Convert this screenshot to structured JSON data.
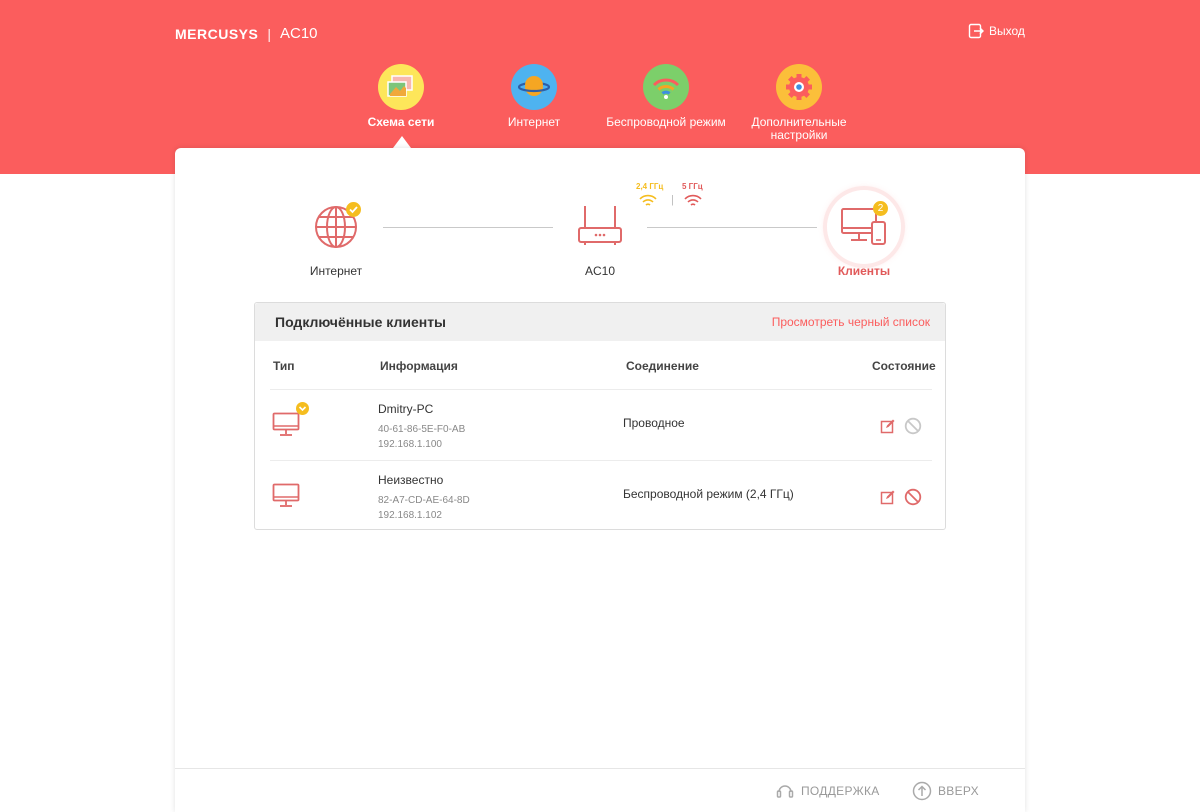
{
  "header": {
    "brand": "MERCUSYS",
    "separator": "|",
    "model": "AC10",
    "logout_label": "Выход"
  },
  "nav": {
    "items": [
      {
        "label": "Схема сети",
        "icon": "network-map-icon",
        "active": true
      },
      {
        "label": "Интернет",
        "icon": "internet-planet-icon",
        "active": false
      },
      {
        "label": "Беспроводной режим",
        "icon": "wireless-icon",
        "active": false
      },
      {
        "label": "Дополнительные настройки",
        "icon": "gear-icon",
        "active": false
      }
    ]
  },
  "topology": {
    "internet_label": "Интернет",
    "router_label": "AC10",
    "clients_label": "Клиенты",
    "clients_count": "2",
    "band_24": "2,4 ГГц",
    "band_5": "5 ГГц",
    "band_sep": "|"
  },
  "clients_panel": {
    "title": "Подключённые клиенты",
    "blacklist_link": "Просмотреть черный список",
    "columns": {
      "type": "Тип",
      "info": "Информация",
      "connection": "Соединение",
      "status": "Состояние"
    },
    "rows": [
      {
        "name": "Dmitry-PC",
        "mac": "40-61-86-5E-F0-AB",
        "ip": "192.168.1.100",
        "connection": "Проводное",
        "current_device": true
      },
      {
        "name": "Неизвестно",
        "mac": "82-A7-CD-AE-64-8D",
        "ip": "192.168.1.102",
        "connection": "Беспроводной режим (2,4 ГГц)",
        "current_device": false
      }
    ]
  },
  "footer": {
    "support_label": "ПОДДЕРЖКА",
    "top_label": "ВВЕРХ"
  },
  "colors": {
    "brand_red": "#fb5d5d",
    "badge_yellow": "#f5bd1f",
    "wifi_24": "#f5bd1f",
    "wifi_5": "#e15a5a"
  }
}
